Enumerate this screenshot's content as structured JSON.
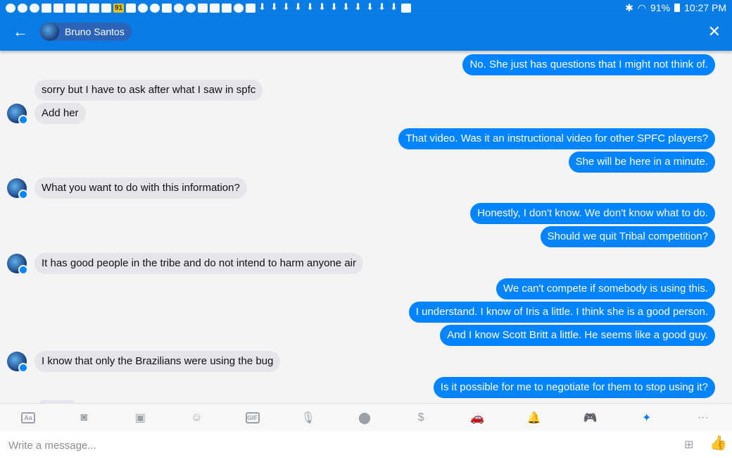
{
  "status_bar": {
    "time": "10:27 PM",
    "battery": "91%",
    "badge": "91"
  },
  "header": {
    "back_icon": "arrow-left-icon",
    "contact_name": "Bruno Santos",
    "close_icon": "close-icon"
  },
  "messages": [
    {
      "dir": "out",
      "text": "No. She just has questions that I might not think of."
    },
    {
      "dir": "in",
      "text": "sorry but I have to ask after what I saw in spfc"
    },
    {
      "dir": "in",
      "text": "Add her"
    },
    {
      "dir": "out",
      "text": "That video. Was it an instructional video for other SPFC players?"
    },
    {
      "dir": "out",
      "text": "She will be here in a minute."
    },
    {
      "dir": "in",
      "text": "What you want to do with this information?"
    },
    {
      "dir": "out",
      "text": "Honestly, I don't know. We don't know what to do."
    },
    {
      "dir": "out",
      "text": "Should we quit Tribal competition?"
    },
    {
      "dir": "in",
      "text": "It has good people in the tribe and do not intend to harm anyone air"
    },
    {
      "dir": "out",
      "text": "We can't compete if somebody is using this."
    },
    {
      "dir": "out",
      "text": "I understand. I know of Iris a little. I think she is a good person."
    },
    {
      "dir": "out",
      "text": "And I know Scott Britt a little. He seems like a good guy."
    },
    {
      "dir": "in",
      "text": "I know that only the Brazilians were using the bug"
    },
    {
      "dir": "out",
      "text": "Is it possible for me to negotiate for them to stop using it?"
    }
  ],
  "toolbar": {
    "items": [
      {
        "name": "text-format-icon",
        "glyph": "Aa"
      },
      {
        "name": "camera-icon",
        "glyph": "◙"
      },
      {
        "name": "image-icon",
        "glyph": "▣"
      },
      {
        "name": "emoji-icon",
        "glyph": "☺"
      },
      {
        "name": "gif-icon",
        "glyph": "GIF"
      },
      {
        "name": "microphone-icon",
        "glyph": "🎙"
      },
      {
        "name": "location-icon",
        "glyph": "⬤"
      },
      {
        "name": "payment-icon",
        "glyph": "$"
      },
      {
        "name": "car-icon",
        "glyph": "🚗"
      },
      {
        "name": "bell-icon",
        "glyph": "🔔"
      },
      {
        "name": "gamepad-icon",
        "glyph": "🎮"
      },
      {
        "name": "dropbox-icon",
        "glyph": "✦"
      },
      {
        "name": "more-icon",
        "glyph": "···"
      }
    ]
  },
  "composer": {
    "placeholder": "Write a message...",
    "emoji_icon": "stickers-icon",
    "like_icon": "thumbs-up-icon"
  }
}
